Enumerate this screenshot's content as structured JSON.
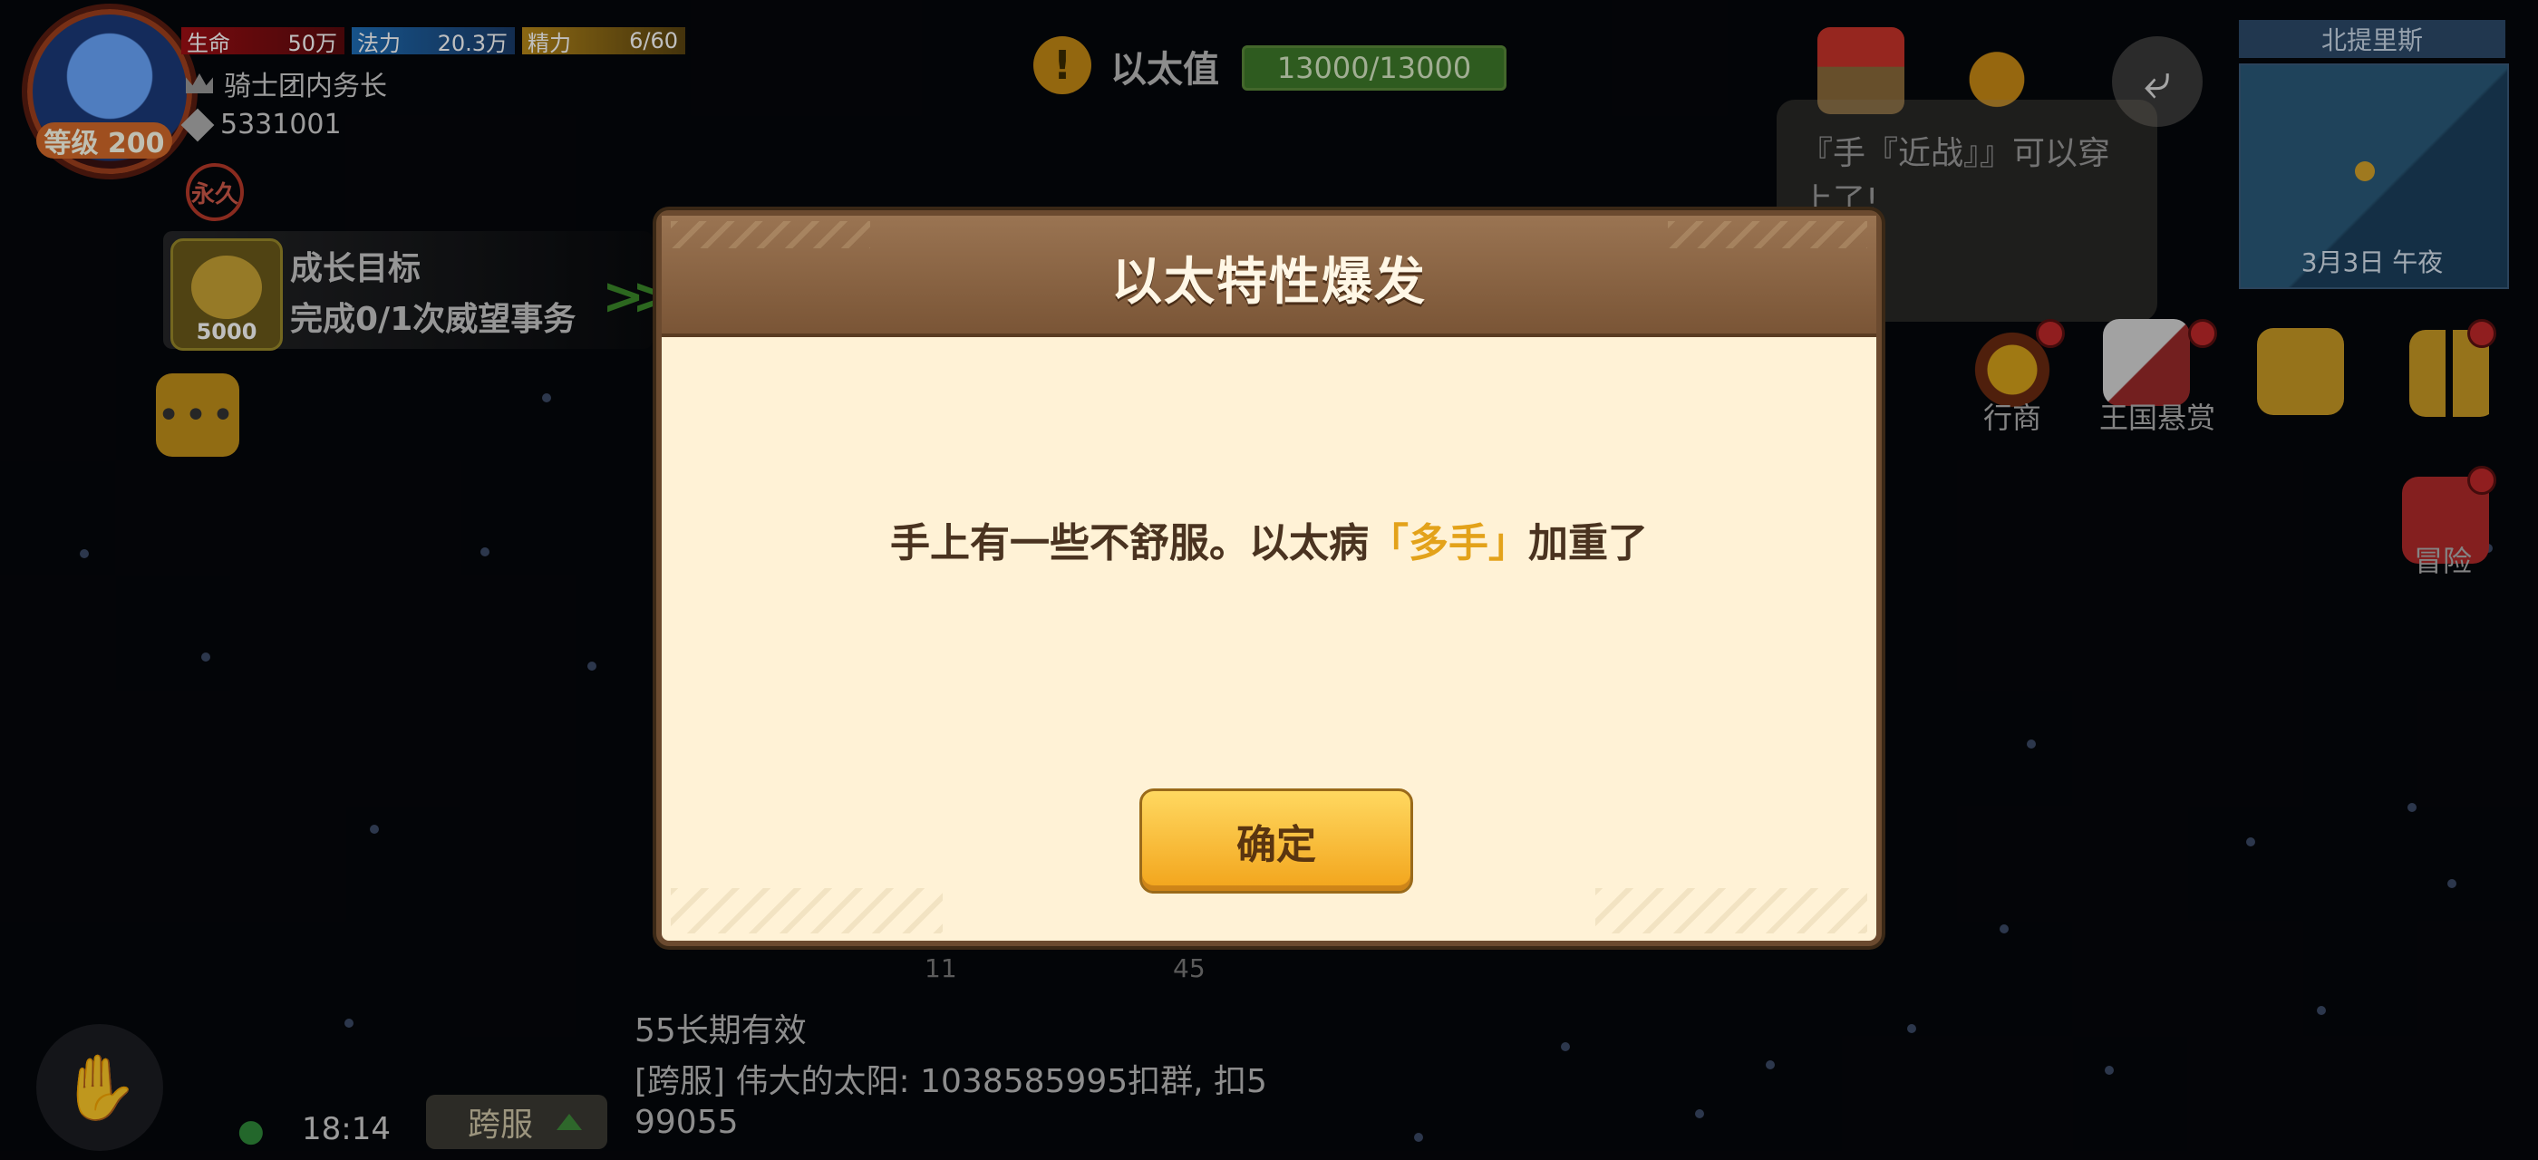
{
  "player": {
    "level_label": "等级 200",
    "title": "骑士团内务长",
    "id_number": "5331001",
    "eternal_badge": "永久",
    "stats": [
      {
        "label": "生命",
        "value": "50万"
      },
      {
        "label": "法力",
        "value": "20.3万"
      },
      {
        "label": "精力",
        "value": "6/60"
      }
    ]
  },
  "growth_goal": {
    "title": "成长目标",
    "subtitle": "完成0/1次威望事务",
    "reward": "5000"
  },
  "more_button": "•••",
  "ether": {
    "label": "以太值",
    "value": "13000/13000"
  },
  "top_right": {
    "market_label": "集市",
    "speech_text": "『手『近战』』可以穿上了!"
  },
  "minimap": {
    "location": "北提里斯",
    "time": "3月3日  午夜"
  },
  "side_menu": [
    {
      "label": "行商"
    },
    {
      "label": "王国悬赏"
    },
    {
      "label": "冒险"
    }
  ],
  "bottom_bar": {
    "clock": "18:14",
    "server_button": "跨服",
    "chat_lines": [
      "55长期有效",
      "[跨服] 伟大的太阳: 1038585995扣群, 扣5",
      "99055"
    ],
    "obscured_numbers": [
      "11",
      "45"
    ]
  },
  "dialog": {
    "title": "以太特性爆发",
    "message_prefix": "手上有一些不舒服。以太病",
    "message_highlight": "「多手」",
    "message_suffix": "加重了",
    "confirm_label": "确定"
  },
  "colors": {
    "dialog_bg": "#fff2d6",
    "dialog_header": "#8a6545",
    "highlight": "#e3a21a",
    "button": "#f2a41b"
  }
}
